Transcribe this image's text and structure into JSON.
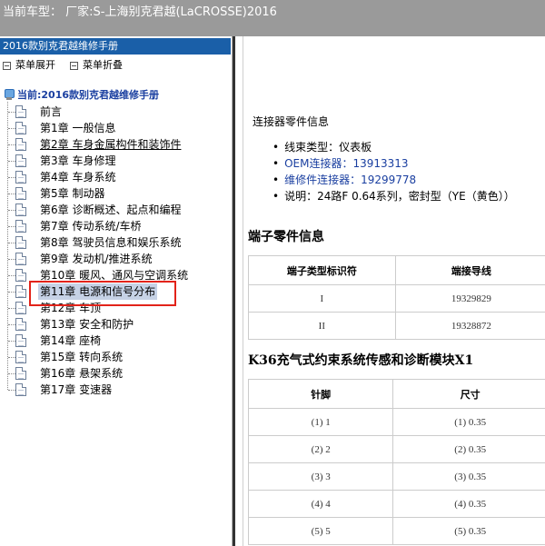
{
  "window": {
    "title": "当前车型： 厂家:S-上海别克君越(LaCROSSE)2016"
  },
  "sidebar": {
    "manual_title": "2016款别克君越维修手册",
    "expand_label": "菜单展开",
    "collapse_label": "菜单折叠",
    "current_label": "当前:2016款别克君越维修手册",
    "items": [
      {
        "label": "前言"
      },
      {
        "label": "第1章 一般信息"
      },
      {
        "label": "第2章 车身金属构件和装饰件"
      },
      {
        "label": "第3章 车身修理"
      },
      {
        "label": "第4章 车身系统"
      },
      {
        "label": "第5章 制动器"
      },
      {
        "label": "第6章 诊断概述、起点和编程"
      },
      {
        "label": "第7章 传动系统/车桥"
      },
      {
        "label": "第8章 驾驶员信息和娱乐系统"
      },
      {
        "label": "第9章 发动机/推进系统"
      },
      {
        "label": "第10章 暖风、通风与空调系统"
      },
      {
        "label": "第11章 电源和信号分布"
      },
      {
        "label": "第12章 车顶"
      },
      {
        "label": "第13章 安全和防护"
      },
      {
        "label": "第14章 座椅"
      },
      {
        "label": "第15章 转向系统"
      },
      {
        "label": "第16章 悬架系统"
      },
      {
        "label": "第17章 变速器"
      }
    ]
  },
  "content": {
    "connector_title": "连接器零件信息",
    "connector_info": [
      {
        "label": "线束类型：",
        "value": "仪表板"
      },
      {
        "label": "OEM连接器：",
        "value": "13913313"
      },
      {
        "label": "维修件连接器：",
        "value": "19299778"
      },
      {
        "label": "说明：",
        "value": "24路F 0.64系列，密封型（YE（黄色））"
      }
    ],
    "terminal_title": "端子零件信息",
    "terminal_table": {
      "headers": [
        "端子类型标识符",
        "端接导线"
      ],
      "rows": [
        [
          "I",
          "19329829"
        ],
        [
          "II",
          "19328872"
        ]
      ]
    },
    "module_title": "K36充气式约束系统传感和诊断模块X1",
    "pin_table": {
      "headers": [
        "针脚",
        "尺寸"
      ],
      "rows": [
        [
          "(1) 1",
          "(1) 0.35"
        ],
        [
          "(2) 2",
          "(2) 0.35"
        ],
        [
          "(3) 3",
          "(3) 0.35"
        ],
        [
          "(4) 4",
          "(4) 0.35"
        ],
        [
          "(5) 5",
          "(5) 0.35"
        ]
      ]
    }
  }
}
